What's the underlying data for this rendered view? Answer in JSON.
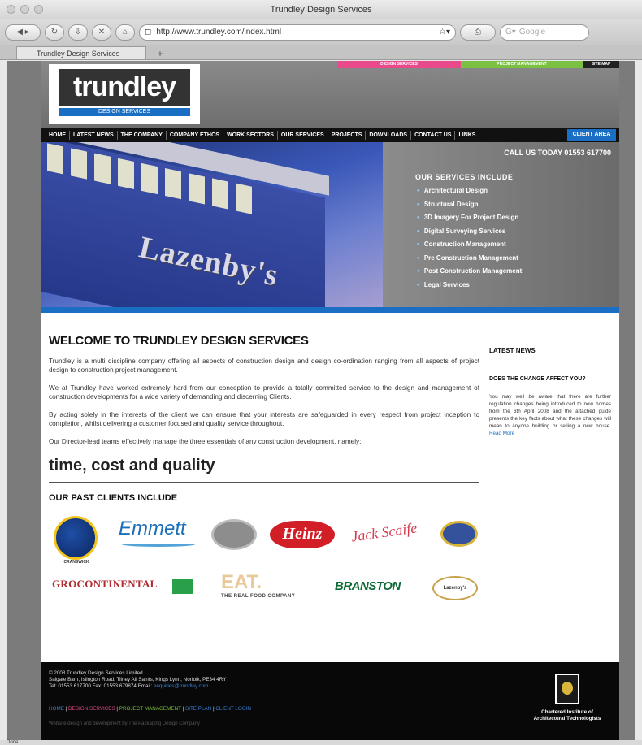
{
  "window": {
    "title": "Trundley Design Services"
  },
  "toolbar": {
    "url": "http://www.trundley.com/index.html",
    "search_placeholder": "Google"
  },
  "tab": {
    "label": "Trundley Design Services",
    "new_tab": "+"
  },
  "header": {
    "logo_text": "trundley",
    "logo_sub": "DESIGN SERVICES",
    "top_links": [
      "DESIGN SERVICES",
      "PROJECT MANAGEMENT",
      "SITE MAP"
    ]
  },
  "nav": {
    "items": [
      "HOME",
      "LATEST NEWS",
      "THE COMPANY",
      "COMPANY ETHOS",
      "WORK SECTORS",
      "OUR SERVICES",
      "PROJECTS",
      "DOWNLOADS",
      "CONTACT US",
      "LINKS"
    ],
    "client_area": "CLIENT AREA"
  },
  "hero": {
    "sign": "Lazenby's",
    "call_us": "CALL US TODAY 01553 617700",
    "services_title": "OUR SERVICES INCLUDE",
    "services": [
      "Architectural Design",
      "Structural Design",
      "3D Imagery For Project Design",
      "Digital Surveying Services",
      "Construction Management",
      "Pre Construction Management",
      "Post Construction Management",
      "Legal Services"
    ]
  },
  "main": {
    "welcome": "WELCOME TO TRUNDLEY DESIGN SERVICES",
    "paragraphs": [
      "Trundley is a multi discipline company offering all aspects of construction design and design co-ordination ranging from all aspects of project design to construction project management.",
      "We at Trundley have worked extremely hard from our conception to provide a totally committed service to the design and management of construction developments for a wide variety of demanding and discerning Clients.",
      "By acting solely in the interests of the client we can ensure that your interests are safeguarded in every respect from project inception to completion, whilst delivering a customer focused and quality service throughout.",
      "Our Director-lead teams effectively manage the three essentials of any construction development, namely:"
    ],
    "slogan": "time, cost and quality",
    "clients_title": "OUR PAST CLIENTS INCLUDE",
    "clients": {
      "cranswick": "CRANSWICK",
      "emmett": "Emmett",
      "heinz": "Heinz",
      "jack": "Jack Scaife",
      "grocontinental": "GROCONTINENTAL",
      "eat": "EAT.",
      "eat_sub": "THE REAL FOOD COMPANY",
      "branston": "BRANSTON",
      "lazenby": "Lazenby's"
    }
  },
  "sidebar": {
    "latest_news": "LATEST NEWS",
    "news_title": "DOES THE CHANGE AFFECT YOU?",
    "news_text": "You may well be aware that there are further regulation changes being introduced to new homes from the 6th April 2008 and the attached guide presents the key facts about what these changes will mean to anyone building or selling a new house.",
    "news_more": "Read More"
  },
  "footer": {
    "copyright": "© 2008 Trundley Design Services Limited",
    "address": "Salgate Barn, Islington Road, Tilney All Saints, Kings Lynn, Norfolk, PE34 4RY",
    "phone": "Tel: 01553 617700  Fax: 01553 679874  Email:",
    "email": "enquiries@trundley.com",
    "links": [
      "HOME",
      "DESIGN SERVICES",
      "PROJECT MANAGEMENT",
      "SITE PLAN",
      "CLIENT LOGIN"
    ],
    "credit": "Website design and development by The Packaging Design Company",
    "ciat": "Chartered Institute of Architectural Technologists"
  },
  "status": {
    "text": "Done"
  }
}
